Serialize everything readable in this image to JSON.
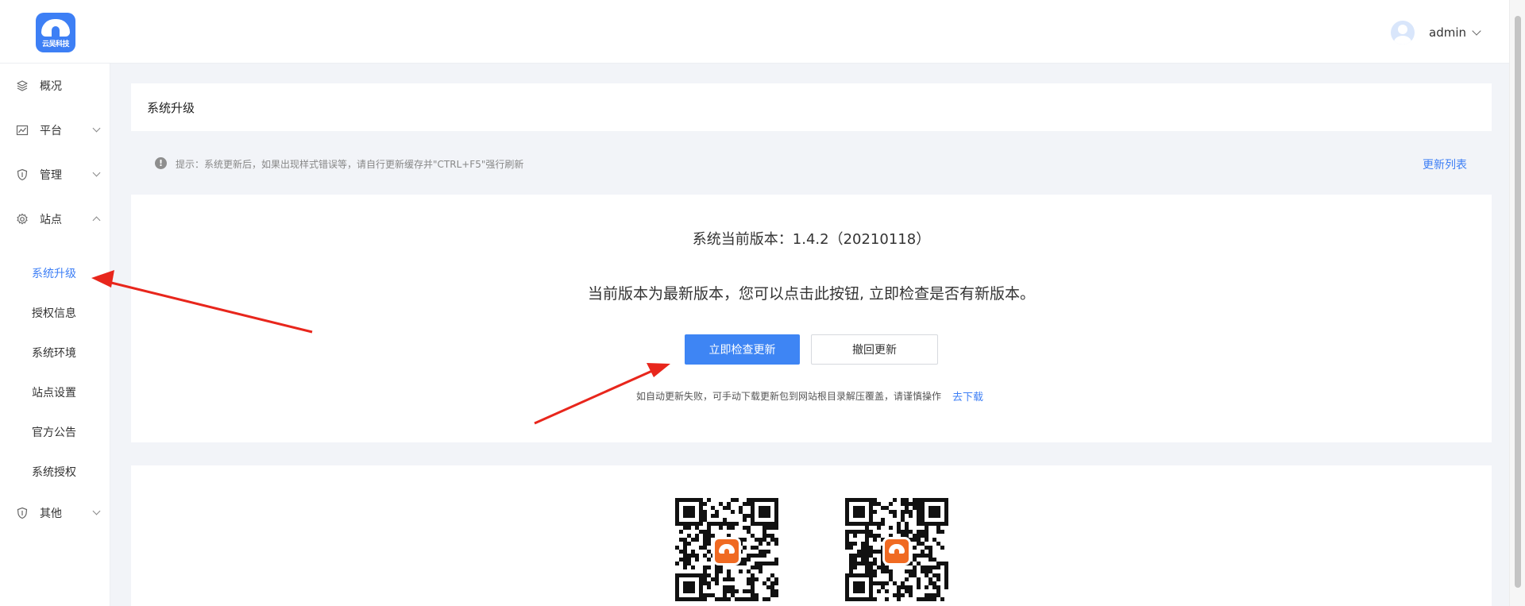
{
  "header": {
    "logo_text": "云吴科技",
    "user_name": "admin"
  },
  "sidebar": {
    "items": [
      {
        "label": "概况",
        "icon": "layers-icon"
      },
      {
        "label": "平台",
        "icon": "chart-icon"
      },
      {
        "label": "管理",
        "icon": "shield-icon"
      },
      {
        "label": "站点",
        "icon": "gear-icon"
      },
      {
        "label": "其他",
        "icon": "shield-icon"
      }
    ],
    "sub_items": [
      "系统升级",
      "授权信息",
      "系统环境",
      "站点设置",
      "官方公告",
      "系统授权"
    ]
  },
  "page": {
    "title": "系统升级",
    "tip_icon": "!",
    "tip": "提示：系统更新后，如果出现样式错误等，请自行更新缓存并\"CTRL+F5\"强行刷新",
    "update_list": "更新列表",
    "version": "系统当前版本：1.4.2（20210118）",
    "notice": "当前版本为最新版本，您可以点击此按钮, 立即检查是否有新版本。",
    "check_button": "立即检查更新",
    "rollback_button": "撤回更新",
    "manual_text": "如自动更新失败，可手动下载更新包到网站根目录解压覆盖，请谨慎操作",
    "download_link": "去下载"
  },
  "colors": {
    "accent": "#3e7ff5",
    "annotation_arrow": "#e8261c"
  }
}
